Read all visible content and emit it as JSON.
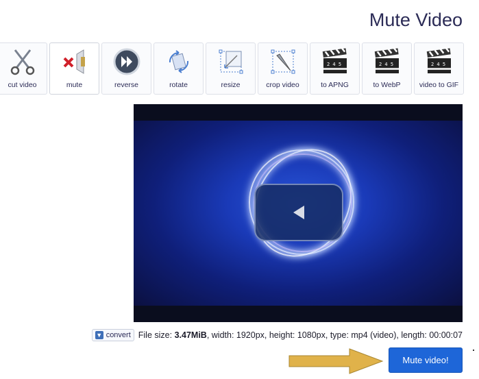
{
  "page": {
    "title": "Mute Video"
  },
  "toolbar": {
    "tools": [
      {
        "label": "video to GIF",
        "icon": "clapperboard-icon"
      },
      {
        "label": "to WebP",
        "icon": "clapperboard-icon"
      },
      {
        "label": "to APNG",
        "icon": "clapperboard-icon"
      },
      {
        "label": "crop video",
        "icon": "crop-icon"
      },
      {
        "label": "resize",
        "icon": "resize-icon"
      },
      {
        "label": "rotate",
        "icon": "rotate-icon"
      },
      {
        "label": "reverse",
        "icon": "reverse-icon"
      },
      {
        "label": "mute",
        "icon": "mute-speaker-icon",
        "active": true
      },
      {
        "label": "cut video",
        "icon": "scissors-icon"
      }
    ]
  },
  "file_info": {
    "prefix": "File size:",
    "size": "3.47MiB",
    "details": ", width: 1920px, height: 1080px, type: mp4 (video), length: 00:00:07",
    "convert_label": "convert"
  },
  "actions": {
    "mute_button": "Mute video!"
  },
  "colors": {
    "accent": "#1e66d8",
    "title": "#2b2b56",
    "arrow": "#e0b24a"
  }
}
